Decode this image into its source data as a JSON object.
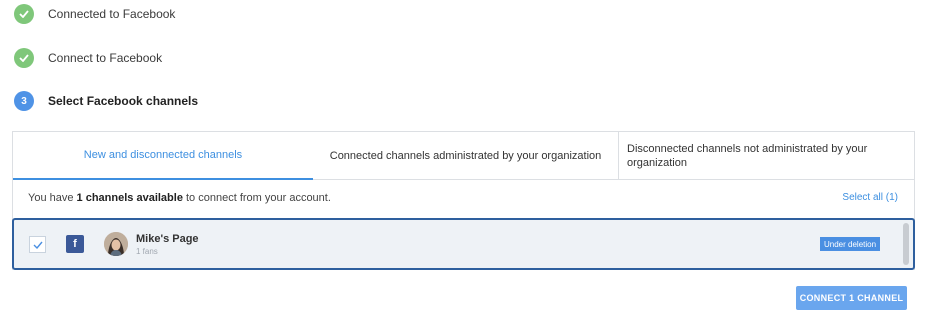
{
  "steps": [
    {
      "label": "Connected to Facebook",
      "state": "done"
    },
    {
      "label": "Connect to Facebook",
      "state": "done"
    },
    {
      "number": "3",
      "label": "Select Facebook channels",
      "state": "active"
    }
  ],
  "tabs": {
    "new": "New and disconnected channels",
    "connected": "Connected channels administrated by your organization",
    "disconnected": "Disconnected channels not administrated by your organization"
  },
  "info": {
    "prefix": "You have",
    "count_text": "1 channels available",
    "suffix": "to connect from your account.",
    "select_all": "Select all (1)"
  },
  "channel": {
    "name": "Mike's Page",
    "fans": "1 fans",
    "badge": "Under deletion",
    "icon": "facebook-icon",
    "checked": true
  },
  "connect_button": "CONNECT 1 CHANNEL",
  "colors": {
    "accent": "#3d8fe0",
    "success": "#7fc77a",
    "facebook": "#3b5998",
    "row_border": "#2e5f9e"
  }
}
